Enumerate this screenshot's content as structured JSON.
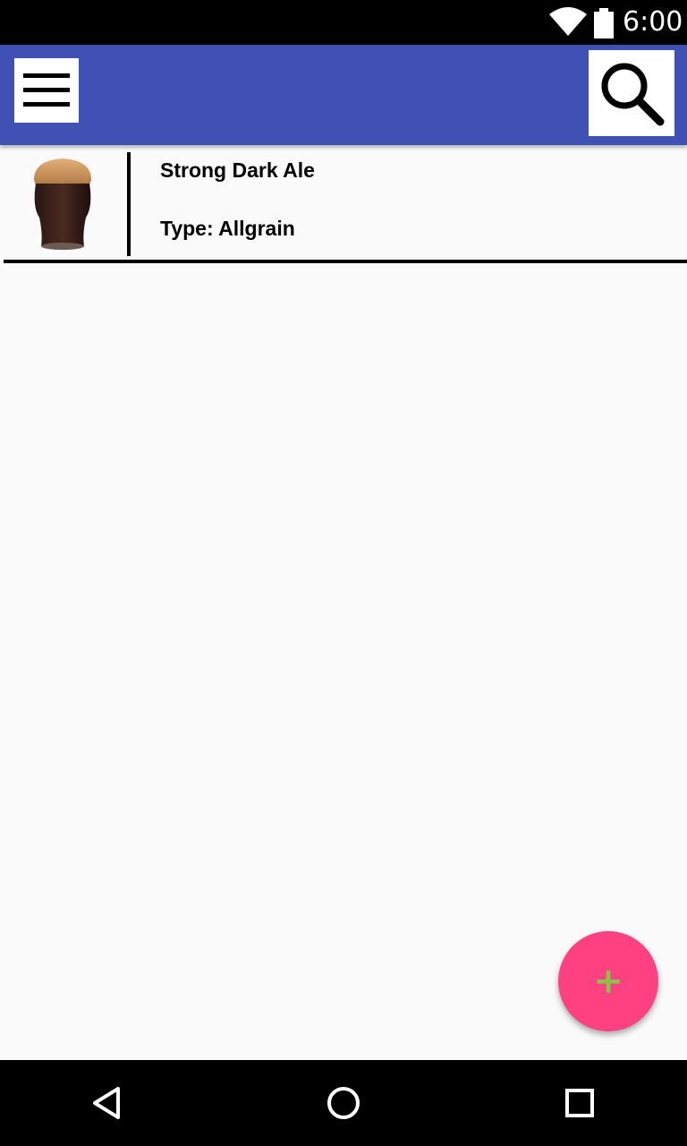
{
  "status_bar": {
    "time": "6:00",
    "icons": [
      "wifi-icon",
      "battery-icon"
    ]
  },
  "app_bar": {
    "background": "#3f51b5",
    "menu_icon": "hamburger-menu-icon",
    "search_icon": "search-icon"
  },
  "recipes": [
    {
      "name": "Strong Dark Ale",
      "type": "Type: Allgrain",
      "image_icon": "dark-ale-glass-image"
    }
  ],
  "fab": {
    "icon": "plus-icon",
    "label": "+",
    "color": "#ff4081",
    "icon_color": "#8bc34a"
  },
  "nav_bar": {
    "icons": [
      "back-icon",
      "home-icon",
      "recents-icon"
    ]
  }
}
